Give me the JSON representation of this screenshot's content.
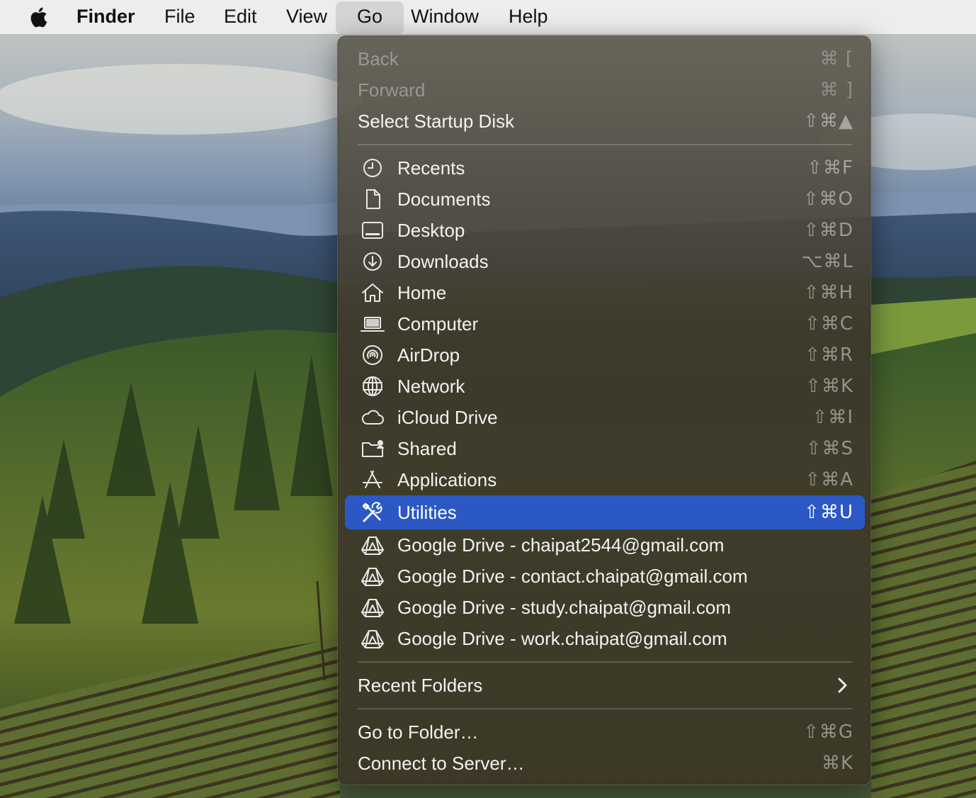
{
  "menubar": {
    "items": [
      {
        "label": "Finder"
      },
      {
        "label": "File"
      },
      {
        "label": "Edit"
      },
      {
        "label": "View"
      },
      {
        "label": "Go"
      },
      {
        "label": "Window"
      },
      {
        "label": "Help"
      }
    ],
    "active": "Go"
  },
  "menu": {
    "back": {
      "label": "Back",
      "shortcut": "⌘ ["
    },
    "forward": {
      "label": "Forward",
      "shortcut": "⌘ ]"
    },
    "startup": {
      "label": "Select Startup Disk",
      "shortcut": "⇧⌘▲"
    },
    "places": [
      {
        "label": "Recents",
        "shortcut": "⇧⌘F",
        "icon": "clock-icon"
      },
      {
        "label": "Documents",
        "shortcut": "⇧⌘O",
        "icon": "document-icon"
      },
      {
        "label": "Desktop",
        "shortcut": "⇧⌘D",
        "icon": "desktop-icon"
      },
      {
        "label": "Downloads",
        "shortcut": "⌥⌘L",
        "icon": "download-icon"
      },
      {
        "label": "Home",
        "shortcut": "⇧⌘H",
        "icon": "house-icon"
      },
      {
        "label": "Computer",
        "shortcut": "⇧⌘C",
        "icon": "laptop-icon"
      },
      {
        "label": "AirDrop",
        "shortcut": "⇧⌘R",
        "icon": "airdrop-icon"
      },
      {
        "label": "Network",
        "shortcut": "⇧⌘K",
        "icon": "globe-icon"
      },
      {
        "label": "iCloud Drive",
        "shortcut": "⇧⌘I",
        "icon": "cloud-icon"
      },
      {
        "label": "Shared",
        "shortcut": "⇧⌘S",
        "icon": "shared-folder-icon"
      },
      {
        "label": "Applications",
        "shortcut": "⇧⌘A",
        "icon": "applications-icon"
      },
      {
        "label": "Utilities",
        "shortcut": "⇧⌘U",
        "icon": "tools-icon",
        "selected": true
      }
    ],
    "drives": [
      {
        "label": "Google Drive - chaipat2544@gmail.com",
        "icon": "google-drive-icon"
      },
      {
        "label": "Google Drive - contact.chaipat@gmail.com",
        "icon": "google-drive-icon"
      },
      {
        "label": "Google Drive - study.chaipat@gmail.com",
        "icon": "google-drive-icon"
      },
      {
        "label": "Google Drive - work.chaipat@gmail.com",
        "icon": "google-drive-icon"
      }
    ],
    "recent_folders": {
      "label": "Recent Folders"
    },
    "go_to_folder": {
      "label": "Go to Folder…",
      "shortcut": "⇧⌘G"
    },
    "connect_server": {
      "label": "Connect to Server…",
      "shortcut": "⌘K"
    }
  },
  "colors": {
    "selection": "#2b58c4",
    "menubar": "#eeeeec"
  }
}
